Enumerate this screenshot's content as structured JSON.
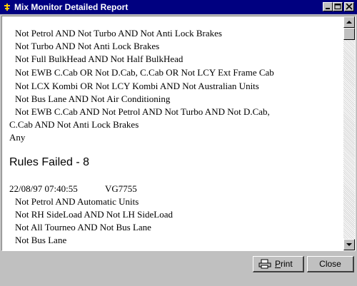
{
  "window": {
    "title": "Mix Monitor Detailed Report",
    "title_icon": "app-icon",
    "controls": [
      "minimize-icon",
      "maximize-icon",
      "close-icon"
    ],
    "titlebar_color": "#000080"
  },
  "report": {
    "lines_top": [
      "Not Petrol AND Not Turbo AND Not Anti Lock Brakes",
      "Not Turbo AND Not Anti Lock Brakes",
      "Not Full BulkHead AND Not Half BulkHead",
      "Not EWB C.Cab OR Not D.Cab, C.Cab OR Not LCY Ext Frame Cab",
      "Not LCX Kombi OR Not LCY Kombi AND  Not Australian Units",
      "Not Bus Lane AND Not Air Conditioning",
      "Not EWB C.Cab AND  Not Petrol AND Not Turbo AND  Not D.Cab,",
      "C.Cab AND  Not Anti Lock Brakes",
      "Any"
    ],
    "rules_failed_heading": "Rules Failed - 8",
    "record": {
      "timestamp": "22/08/97 07:40:55",
      "vehicle": "VG7755"
    },
    "lines_bottom": [
      "Not Petrol AND  Automatic Units",
      "Not RH SideLoad AND Not LH SideLoad",
      "Not All Tourneo AND Not Bus Lane",
      "Not Bus Lane"
    ]
  },
  "buttons": {
    "print_label": "Print",
    "print_icon": "printer-icon",
    "close_label": "Close"
  }
}
